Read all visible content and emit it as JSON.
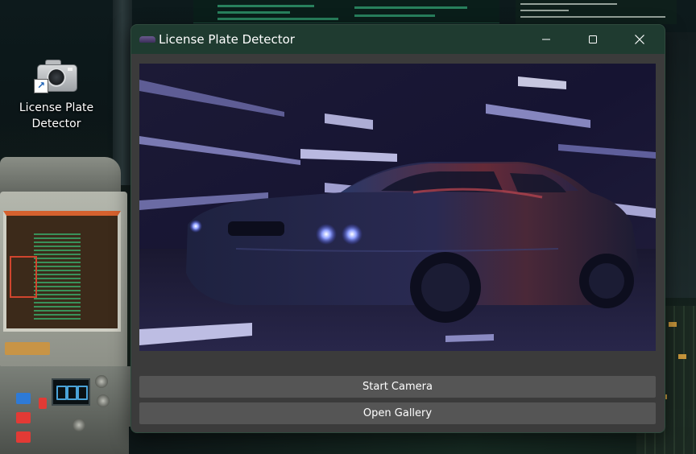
{
  "desktop": {
    "shortcut": {
      "icon": "camera-icon",
      "label": "License Plate\nDetector"
    }
  },
  "window": {
    "title": "License Plate Detector",
    "controls": {
      "minimize_icon": "minimize-icon",
      "maximize_icon": "maximize-icon",
      "close_icon": "close-icon"
    },
    "preview_image": "car-photo",
    "buttons": {
      "start_camera": "Start Camera",
      "open_gallery": "Open Gallery"
    }
  },
  "colors": {
    "titlebar": "#1f3b30",
    "window_bg": "#3b3b3b",
    "button_bg": "#555555",
    "button_text": "#ffffff"
  }
}
